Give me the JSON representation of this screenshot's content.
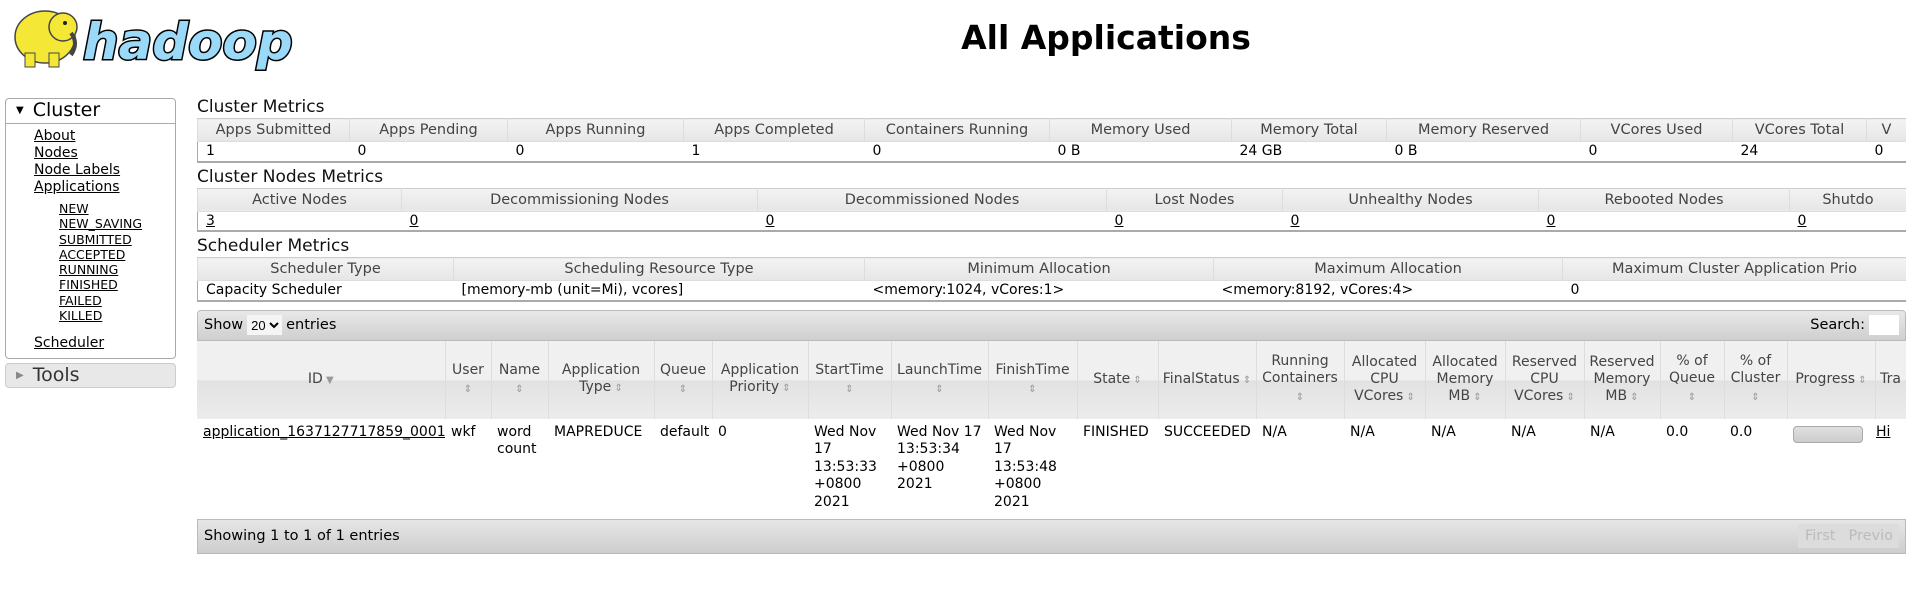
{
  "logo": {
    "text": "hadoop"
  },
  "page_title": "All Applications",
  "sidebar": {
    "cluster_label": "Cluster",
    "items": [
      "About",
      "Nodes",
      "Node Labels",
      "Applications"
    ],
    "app_states": [
      "NEW",
      "NEW_SAVING",
      "SUBMITTED",
      "ACCEPTED",
      "RUNNING",
      "FINISHED",
      "FAILED",
      "KILLED"
    ],
    "scheduler": "Scheduler",
    "tools_label": "Tools"
  },
  "cluster_metrics": {
    "title": "Cluster Metrics",
    "headers": [
      "Apps Submitted",
      "Apps Pending",
      "Apps Running",
      "Apps Completed",
      "Containers Running",
      "Memory Used",
      "Memory Total",
      "Memory Reserved",
      "VCores Used",
      "VCores Total",
      "V"
    ],
    "values": [
      "1",
      "0",
      "0",
      "1",
      "0",
      "0 B",
      "24 GB",
      "0 B",
      "0",
      "24",
      "0"
    ]
  },
  "nodes_metrics": {
    "title": "Cluster Nodes Metrics",
    "headers": [
      "Active Nodes",
      "Decommissioning Nodes",
      "Decommissioned Nodes",
      "Lost Nodes",
      "Unhealthy Nodes",
      "Rebooted Nodes",
      "Shutdo"
    ],
    "values": [
      "3",
      "0",
      "0",
      "0",
      "0",
      "0",
      "0"
    ]
  },
  "scheduler_metrics": {
    "title": "Scheduler Metrics",
    "headers": [
      "Scheduler Type",
      "Scheduling Resource Type",
      "Minimum Allocation",
      "Maximum Allocation",
      "Maximum Cluster Application Prio"
    ],
    "values": [
      "Capacity Scheduler",
      "[memory-mb (unit=Mi), vcores]",
      "<memory:1024, vCores:1>",
      "<memory:8192, vCores:4>",
      "0"
    ]
  },
  "apps_table": {
    "show_label": "Show",
    "entries_value": "20",
    "entries_label": "entries",
    "search_label": "Search:",
    "search_value": "",
    "columns": [
      "ID",
      "User",
      "Name",
      "Application Type",
      "Queue",
      "Application Priority",
      "StartTime",
      "LaunchTime",
      "FinishTime",
      "State",
      "FinalStatus",
      "Running Containers",
      "Allocated CPU VCores",
      "Allocated Memory MB",
      "Reserved CPU VCores",
      "Reserved Memory MB",
      "% of Queue",
      "% of Cluster",
      "Progress",
      "Tra"
    ],
    "rows": [
      {
        "id": "application_1637127717859_0001",
        "user": "wkf",
        "name": "word count",
        "type": "MAPREDUCE",
        "queue": "default",
        "priority": "0",
        "start": "Wed Nov 17 13:53:33 +0800 2021",
        "launch": "Wed Nov 17 13:53:34 +0800 2021",
        "finish": "Wed Nov 17 13:53:48 +0800 2021",
        "state": "FINISHED",
        "final_status": "SUCCEEDED",
        "running_containers": "N/A",
        "alloc_vcores": "N/A",
        "alloc_mem": "N/A",
        "res_vcores": "N/A",
        "res_mem": "N/A",
        "pct_queue": "0.0",
        "pct_cluster": "0.0",
        "progress": 0,
        "tracking": "Hi"
      }
    ],
    "info": "Showing 1 to 1 of 1 entries",
    "pager": [
      "First",
      "Previo"
    ]
  },
  "colors": {
    "logo_blue": "#9ad9f8",
    "elephant": "#f5e736",
    "header_bg": "#e8e8e8"
  }
}
